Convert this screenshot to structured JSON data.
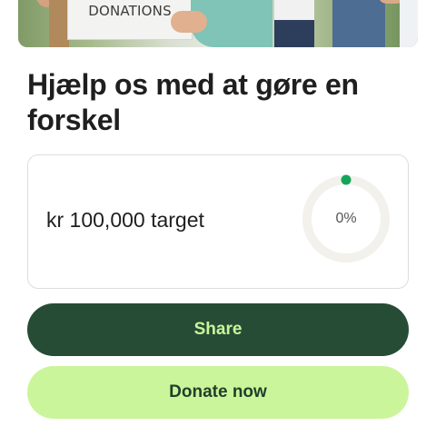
{
  "hero": {
    "sign_text": "DONATIONS"
  },
  "page": {
    "title": "Hjælp os med at gøre en forskel"
  },
  "fundraiser": {
    "target_text": "kr 100,000 target",
    "progress_label": "0%",
    "progress_fraction": 0,
    "colors": {
      "ring_track": "#f2f1ec",
      "ring_indicator": "#16a45a"
    }
  },
  "actions": {
    "share_label": "Share",
    "donate_label": "Donate now"
  },
  "colors": {
    "share_bg": "#264c35",
    "share_text": "#c9f59a",
    "donate_bg": "#cbf59a",
    "donate_text": "#1f3f2a"
  }
}
